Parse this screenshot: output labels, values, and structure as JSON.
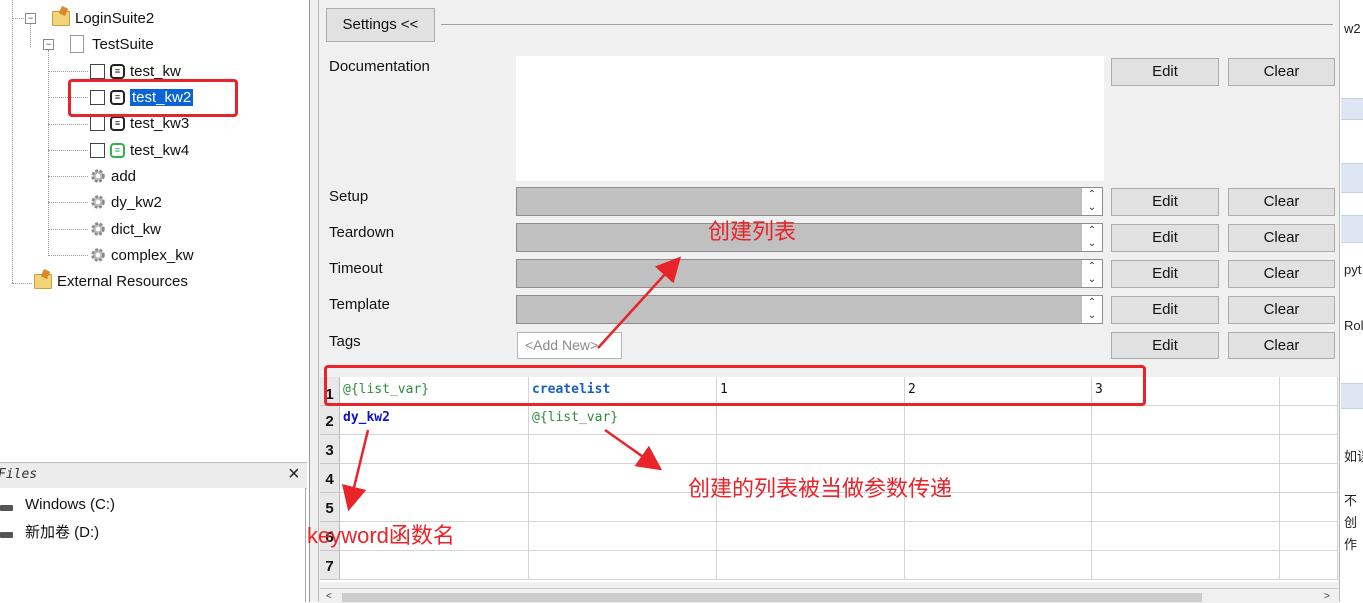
{
  "tree": {
    "suite": "LoginSuite2",
    "test_suite": "TestSuite",
    "keywords": [
      {
        "label": "test_kw",
        "selected": false,
        "icon": "robot-icon"
      },
      {
        "label": "test_kw2",
        "selected": true,
        "icon": "robot-icon"
      },
      {
        "label": "test_kw3",
        "selected": false,
        "icon": "robot-icon"
      },
      {
        "label": "test_kw4",
        "selected": false,
        "icon": "robot-icon-green"
      }
    ],
    "user_keywords": [
      "add",
      "dy_kw2",
      "dict_kw",
      "complex_kw"
    ],
    "external": "External Resources"
  },
  "files": {
    "title": "Files",
    "close": "×",
    "drives": [
      "Windows (C:)",
      "新加卷 (D:)"
    ]
  },
  "settings": {
    "toggle": "Settings <<",
    "documentation": "Documentation",
    "rows": [
      "Setup",
      "Teardown",
      "Timeout",
      "Template"
    ],
    "tags": "Tags",
    "add_new": "<Add New>",
    "edit": "Edit",
    "clear": "Clear"
  },
  "grid": {
    "row_numbers": [
      "1",
      "2",
      "3",
      "4",
      "5",
      "6",
      "7"
    ],
    "rows": [
      [
        "@{list_var}",
        "createlist",
        "1",
        "2",
        "3",
        ""
      ],
      [
        "dy_kw2",
        "@{list_var}",
        "",
        "",
        "",
        ""
      ]
    ]
  },
  "right_strip": [
    "w2",
    "pyt",
    "Rol",
    "如误",
    "不",
    "创",
    "作"
  ],
  "annotations": {
    "create_list": "创建列表",
    "passed_as_param": "创建的列表被当做参数传递",
    "keyword_name": "keyword函数名"
  },
  "colors": {
    "annotation": "#e8232a",
    "selection": "#0a64d6",
    "variable": "#2e8b3c",
    "keyword": "#1a5fbf"
  }
}
